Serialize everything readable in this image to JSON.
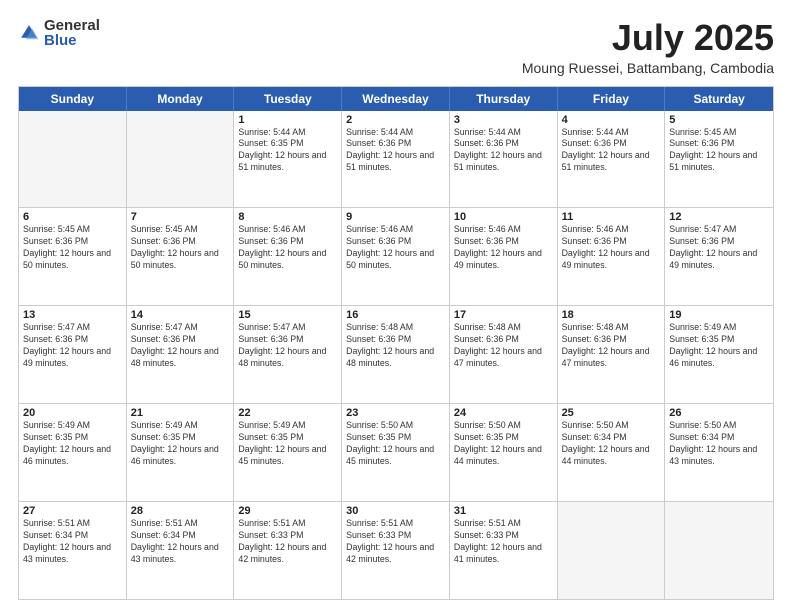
{
  "logo": {
    "general": "General",
    "blue": "Blue"
  },
  "title": "July 2025",
  "location": "Moung Ruessei, Battambang, Cambodia",
  "header_days": [
    "Sunday",
    "Monday",
    "Tuesday",
    "Wednesday",
    "Thursday",
    "Friday",
    "Saturday"
  ],
  "weeks": [
    [
      {
        "day": "",
        "info": ""
      },
      {
        "day": "",
        "info": ""
      },
      {
        "day": "1",
        "info": "Sunrise: 5:44 AM\nSunset: 6:35 PM\nDaylight: 12 hours and 51 minutes."
      },
      {
        "day": "2",
        "info": "Sunrise: 5:44 AM\nSunset: 6:36 PM\nDaylight: 12 hours and 51 minutes."
      },
      {
        "day": "3",
        "info": "Sunrise: 5:44 AM\nSunset: 6:36 PM\nDaylight: 12 hours and 51 minutes."
      },
      {
        "day": "4",
        "info": "Sunrise: 5:44 AM\nSunset: 6:36 PM\nDaylight: 12 hours and 51 minutes."
      },
      {
        "day": "5",
        "info": "Sunrise: 5:45 AM\nSunset: 6:36 PM\nDaylight: 12 hours and 51 minutes."
      }
    ],
    [
      {
        "day": "6",
        "info": "Sunrise: 5:45 AM\nSunset: 6:36 PM\nDaylight: 12 hours and 50 minutes."
      },
      {
        "day": "7",
        "info": "Sunrise: 5:45 AM\nSunset: 6:36 PM\nDaylight: 12 hours and 50 minutes."
      },
      {
        "day": "8",
        "info": "Sunrise: 5:46 AM\nSunset: 6:36 PM\nDaylight: 12 hours and 50 minutes."
      },
      {
        "day": "9",
        "info": "Sunrise: 5:46 AM\nSunset: 6:36 PM\nDaylight: 12 hours and 50 minutes."
      },
      {
        "day": "10",
        "info": "Sunrise: 5:46 AM\nSunset: 6:36 PM\nDaylight: 12 hours and 49 minutes."
      },
      {
        "day": "11",
        "info": "Sunrise: 5:46 AM\nSunset: 6:36 PM\nDaylight: 12 hours and 49 minutes."
      },
      {
        "day": "12",
        "info": "Sunrise: 5:47 AM\nSunset: 6:36 PM\nDaylight: 12 hours and 49 minutes."
      }
    ],
    [
      {
        "day": "13",
        "info": "Sunrise: 5:47 AM\nSunset: 6:36 PM\nDaylight: 12 hours and 49 minutes."
      },
      {
        "day": "14",
        "info": "Sunrise: 5:47 AM\nSunset: 6:36 PM\nDaylight: 12 hours and 48 minutes."
      },
      {
        "day": "15",
        "info": "Sunrise: 5:47 AM\nSunset: 6:36 PM\nDaylight: 12 hours and 48 minutes."
      },
      {
        "day": "16",
        "info": "Sunrise: 5:48 AM\nSunset: 6:36 PM\nDaylight: 12 hours and 48 minutes."
      },
      {
        "day": "17",
        "info": "Sunrise: 5:48 AM\nSunset: 6:36 PM\nDaylight: 12 hours and 47 minutes."
      },
      {
        "day": "18",
        "info": "Sunrise: 5:48 AM\nSunset: 6:36 PM\nDaylight: 12 hours and 47 minutes."
      },
      {
        "day": "19",
        "info": "Sunrise: 5:49 AM\nSunset: 6:35 PM\nDaylight: 12 hours and 46 minutes."
      }
    ],
    [
      {
        "day": "20",
        "info": "Sunrise: 5:49 AM\nSunset: 6:35 PM\nDaylight: 12 hours and 46 minutes."
      },
      {
        "day": "21",
        "info": "Sunrise: 5:49 AM\nSunset: 6:35 PM\nDaylight: 12 hours and 46 minutes."
      },
      {
        "day": "22",
        "info": "Sunrise: 5:49 AM\nSunset: 6:35 PM\nDaylight: 12 hours and 45 minutes."
      },
      {
        "day": "23",
        "info": "Sunrise: 5:50 AM\nSunset: 6:35 PM\nDaylight: 12 hours and 45 minutes."
      },
      {
        "day": "24",
        "info": "Sunrise: 5:50 AM\nSunset: 6:35 PM\nDaylight: 12 hours and 44 minutes."
      },
      {
        "day": "25",
        "info": "Sunrise: 5:50 AM\nSunset: 6:34 PM\nDaylight: 12 hours and 44 minutes."
      },
      {
        "day": "26",
        "info": "Sunrise: 5:50 AM\nSunset: 6:34 PM\nDaylight: 12 hours and 43 minutes."
      }
    ],
    [
      {
        "day": "27",
        "info": "Sunrise: 5:51 AM\nSunset: 6:34 PM\nDaylight: 12 hours and 43 minutes."
      },
      {
        "day": "28",
        "info": "Sunrise: 5:51 AM\nSunset: 6:34 PM\nDaylight: 12 hours and 43 minutes."
      },
      {
        "day": "29",
        "info": "Sunrise: 5:51 AM\nSunset: 6:33 PM\nDaylight: 12 hours and 42 minutes."
      },
      {
        "day": "30",
        "info": "Sunrise: 5:51 AM\nSunset: 6:33 PM\nDaylight: 12 hours and 42 minutes."
      },
      {
        "day": "31",
        "info": "Sunrise: 5:51 AM\nSunset: 6:33 PM\nDaylight: 12 hours and 41 minutes."
      },
      {
        "day": "",
        "info": ""
      },
      {
        "day": "",
        "info": ""
      }
    ]
  ]
}
